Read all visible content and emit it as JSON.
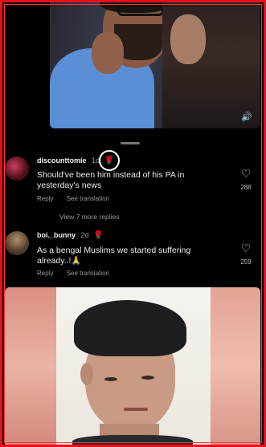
{
  "video": {
    "speaker_icon": "speaker-icon"
  },
  "comments": [
    {
      "username": "discounttomie",
      "time": "1d",
      "badge_icon": "rose-icon",
      "text": "Should've been him instead of his PA in yesterday's news",
      "reply_label": "Reply",
      "translate_label": "See translation",
      "likes": "288"
    },
    {
      "username": "boi._bunny",
      "time": "2d",
      "badge_icon": "rose-icon",
      "text": "As a bengal Muslims we started suffering already..!🙏",
      "reply_label": "Reply",
      "translate_label": "See translation",
      "likes": "259"
    }
  ],
  "view_more_replies": "View 7 more replies",
  "colors": {
    "frame": "#e8101a",
    "background": "#000000"
  }
}
